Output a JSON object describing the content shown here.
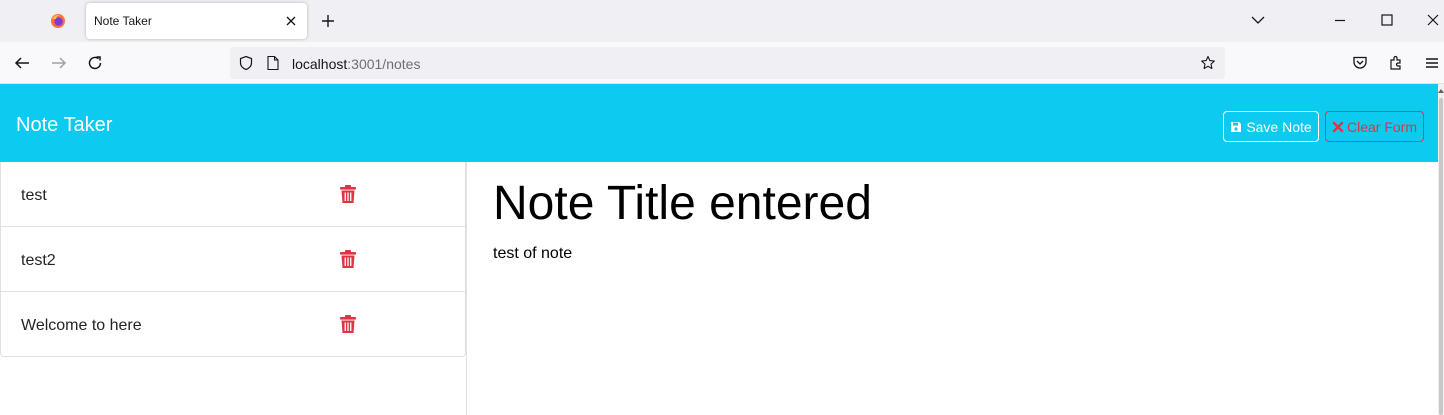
{
  "browser": {
    "tab_title": "Note Taker",
    "url_host": "localhost",
    "url_rest": ":3001/notes"
  },
  "app": {
    "brand": "Note Taker",
    "save_label": "Save Note",
    "clear_label": "Clear Form"
  },
  "notes": [
    {
      "title": "test"
    },
    {
      "title": "test2"
    },
    {
      "title": "Welcome to here"
    }
  ],
  "active_note": {
    "title": "Note Title entered",
    "text": "test of note"
  },
  "colors": {
    "header": "#0dcaf0",
    "danger": "#dc3545"
  },
  "icons": [
    "firefox-icon",
    "close-icon",
    "plus-icon",
    "chevron-down-icon",
    "minimize-icon",
    "maximize-icon",
    "back-icon",
    "forward-icon",
    "reload-icon",
    "shield-icon",
    "page-icon",
    "star-icon",
    "pocket-icon",
    "extensions-icon",
    "menu-icon",
    "save-icon",
    "x-icon",
    "trash-icon"
  ]
}
